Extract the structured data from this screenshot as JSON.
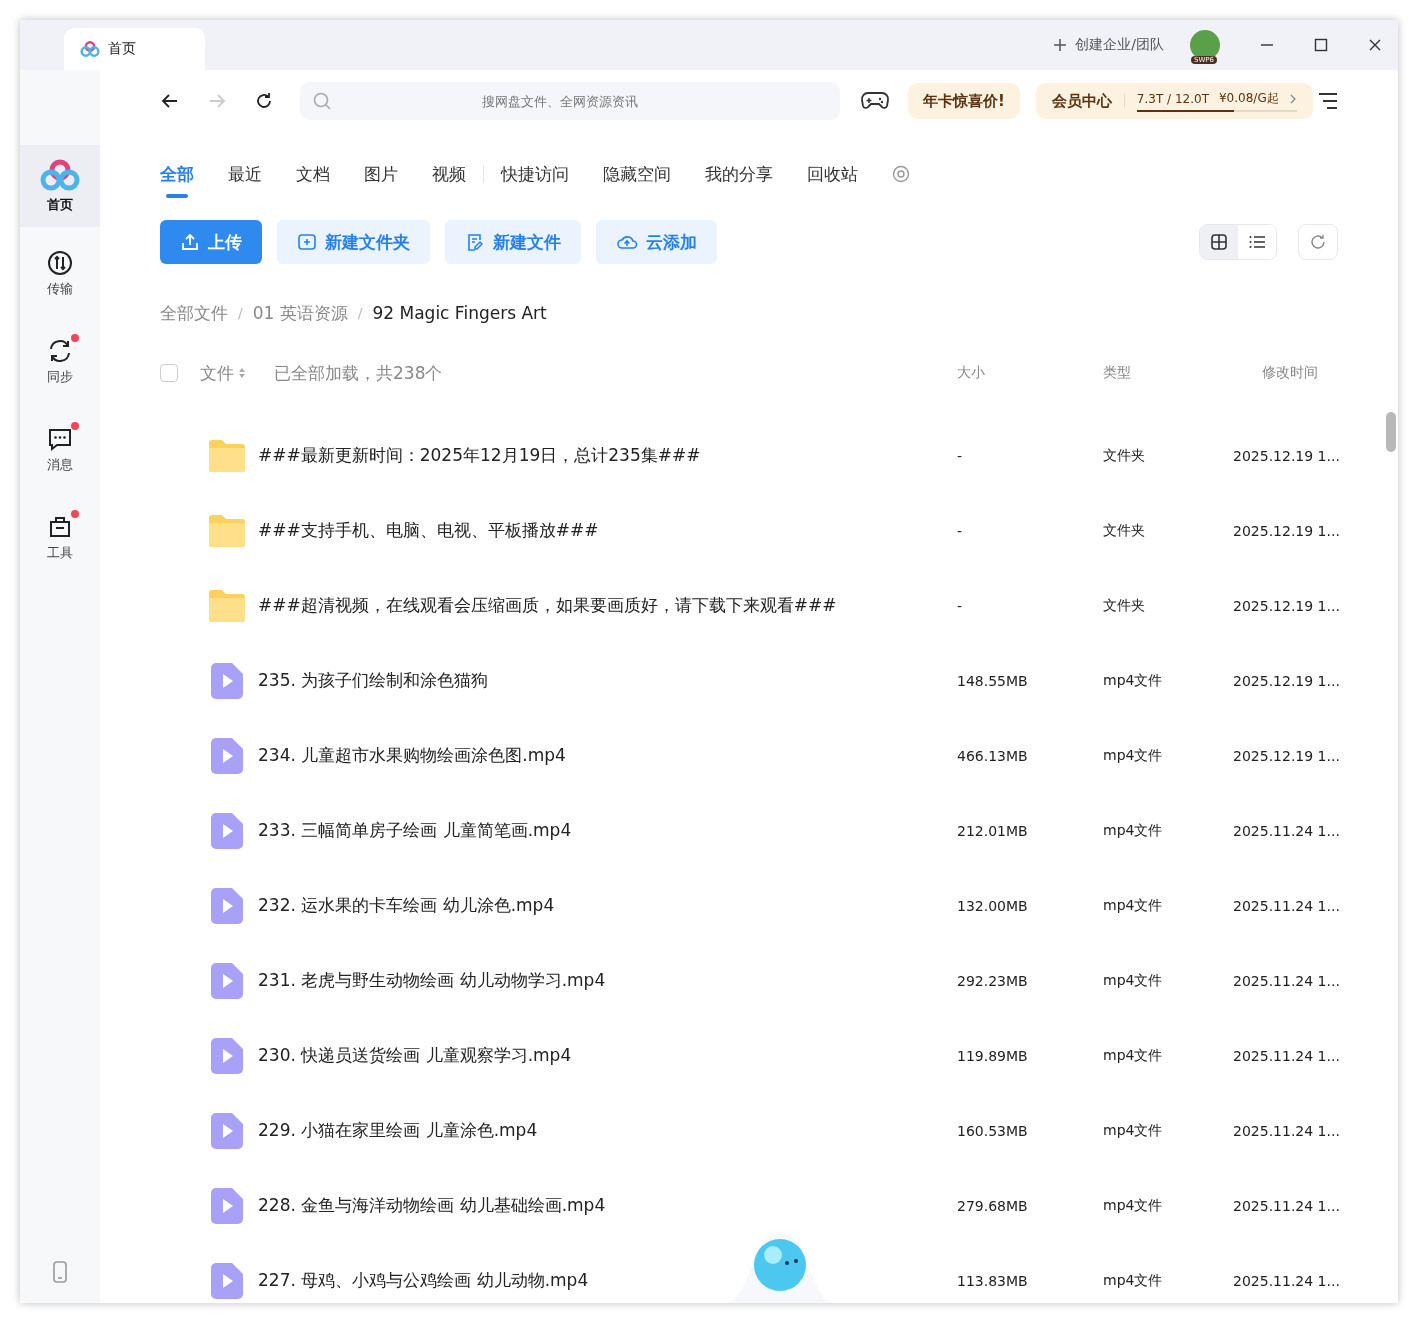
{
  "window": {
    "tab_title": "首页",
    "create_team": "创建企业/团队",
    "avatar_badge": "SWP6"
  },
  "toolbar": {
    "search": {
      "placeholder": "搜网盘文件、全网资源资讯"
    },
    "promo": "年卡惊喜价!",
    "member": {
      "label": "会员中心",
      "storage": "7.3T / 12.0T",
      "level": 0.61,
      "price": "¥0.08/G起"
    }
  },
  "sidebar": {
    "items": [
      {
        "label": "首页",
        "kind": "home",
        "selected": true,
        "dot": false
      },
      {
        "label": "传输",
        "kind": "transfer",
        "selected": false,
        "dot": false
      },
      {
        "label": "同步",
        "kind": "sync",
        "selected": false,
        "dot": true
      },
      {
        "label": "消息",
        "kind": "message",
        "selected": false,
        "dot": true
      },
      {
        "label": "工具",
        "kind": "tools",
        "selected": false,
        "dot": true
      }
    ]
  },
  "tabs": [
    {
      "label": "全部",
      "selected": true
    },
    {
      "label": "最近",
      "selected": false
    },
    {
      "label": "文档",
      "selected": false
    },
    {
      "label": "图片",
      "selected": false
    },
    {
      "label": "视频",
      "selected": false
    },
    {
      "label": "快捷访问",
      "selected": false
    },
    {
      "label": "隐藏空间",
      "selected": false
    },
    {
      "label": "我的分享",
      "selected": false
    },
    {
      "label": "回收站",
      "selected": false
    }
  ],
  "actions": [
    {
      "label": "上传",
      "kind": "upload"
    },
    {
      "label": "新建文件夹",
      "kind": "folder"
    },
    {
      "label": "新建文件",
      "kind": "file"
    },
    {
      "label": "云添加",
      "kind": "cloud"
    }
  ],
  "view": {
    "grid_selected": true
  },
  "breadcrumb": {
    "separator": "/",
    "items": [
      "全部文件",
      "01 英语资源",
      "92 Magic Fingers Art"
    ]
  },
  "table": {
    "select_all_checked": false,
    "name_column": "文件",
    "loaded_note": "已全部加载，共238个",
    "columns": [
      "大小",
      "类型",
      "修改时间"
    ],
    "rows": [
      {
        "kind": "folder",
        "name": "###最新更新时间：2025年12月19日，总计235集###",
        "size": "-",
        "type": "文件夹",
        "modified": "2025.12.19 1..."
      },
      {
        "kind": "folder",
        "name": "###支持手机、电脑、电视、平板播放###",
        "size": "-",
        "type": "文件夹",
        "modified": "2025.12.19 1..."
      },
      {
        "kind": "folder",
        "name": "###超清视频，在线观看会压缩画质，如果要画质好，请下载下来观看###",
        "size": "-",
        "type": "文件夹",
        "modified": "2025.12.19 1..."
      },
      {
        "kind": "video",
        "name": "235. 为孩子们绘制和涂色猫狗",
        "size": "148.55MB",
        "type": "mp4文件",
        "modified": "2025.12.19 1..."
      },
      {
        "kind": "video",
        "name": "234. 儿童超市水果购物绘画涂色图.mp4",
        "size": "466.13MB",
        "type": "mp4文件",
        "modified": "2025.12.19 1..."
      },
      {
        "kind": "video",
        "name": "233. 三幅简单房子绘画 儿童简笔画.mp4",
        "size": "212.01MB",
        "type": "mp4文件",
        "modified": "2025.11.24 1..."
      },
      {
        "kind": "video",
        "name": "232. 运水果的卡车绘画 幼儿涂色.mp4",
        "size": "132.00MB",
        "type": "mp4文件",
        "modified": "2025.11.24 1..."
      },
      {
        "kind": "video",
        "name": "231. 老虎与野生动物绘画 幼儿动物学习.mp4",
        "size": "292.23MB",
        "type": "mp4文件",
        "modified": "2025.11.24 1..."
      },
      {
        "kind": "video",
        "name": "230. 快递员送货绘画 儿童观察学习.mp4",
        "size": "119.89MB",
        "type": "mp4文件",
        "modified": "2025.11.24 1..."
      },
      {
        "kind": "video",
        "name": "229. 小猫在家里绘画 儿童涂色.mp4",
        "size": "160.53MB",
        "type": "mp4文件",
        "modified": "2025.11.24 1..."
      },
      {
        "kind": "video",
        "name": "228. 金鱼与海洋动物绘画 幼儿基础绘画.mp4",
        "size": "279.68MB",
        "type": "mp4文件",
        "modified": "2025.11.24 1..."
      },
      {
        "kind": "video",
        "name": "227. 母鸡、小鸡与公鸡绘画 幼儿动物.mp4",
        "size": "113.83MB",
        "type": "mp4文件",
        "modified": "2025.11.24 1..."
      }
    ]
  }
}
